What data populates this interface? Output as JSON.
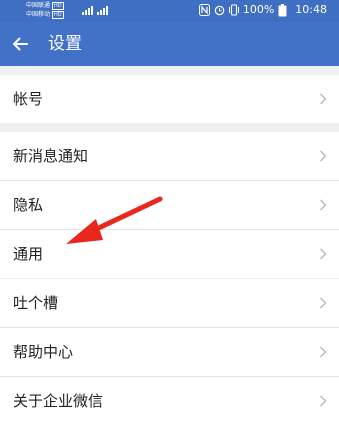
{
  "status_bar": {
    "carrier_1": "中国联通",
    "carrier_2": "中国移动",
    "hd_badge": "HD",
    "battery": "100%",
    "time": "10:48"
  },
  "app_bar": {
    "back_icon": "back-arrow-icon",
    "title": "设置"
  },
  "groups": [
    {
      "items": [
        {
          "label": "帐号"
        }
      ]
    },
    {
      "items": [
        {
          "label": "新消息通知"
        },
        {
          "label": "隐私"
        },
        {
          "label": "通用"
        }
      ]
    },
    {
      "items": [
        {
          "label": "吐个槽"
        },
        {
          "label": "帮助中心"
        },
        {
          "label": "关于企业微信"
        }
      ]
    }
  ],
  "colors": {
    "header": "#4272c7",
    "background": "#efeff4",
    "annotation_arrow": "#e8281e"
  }
}
